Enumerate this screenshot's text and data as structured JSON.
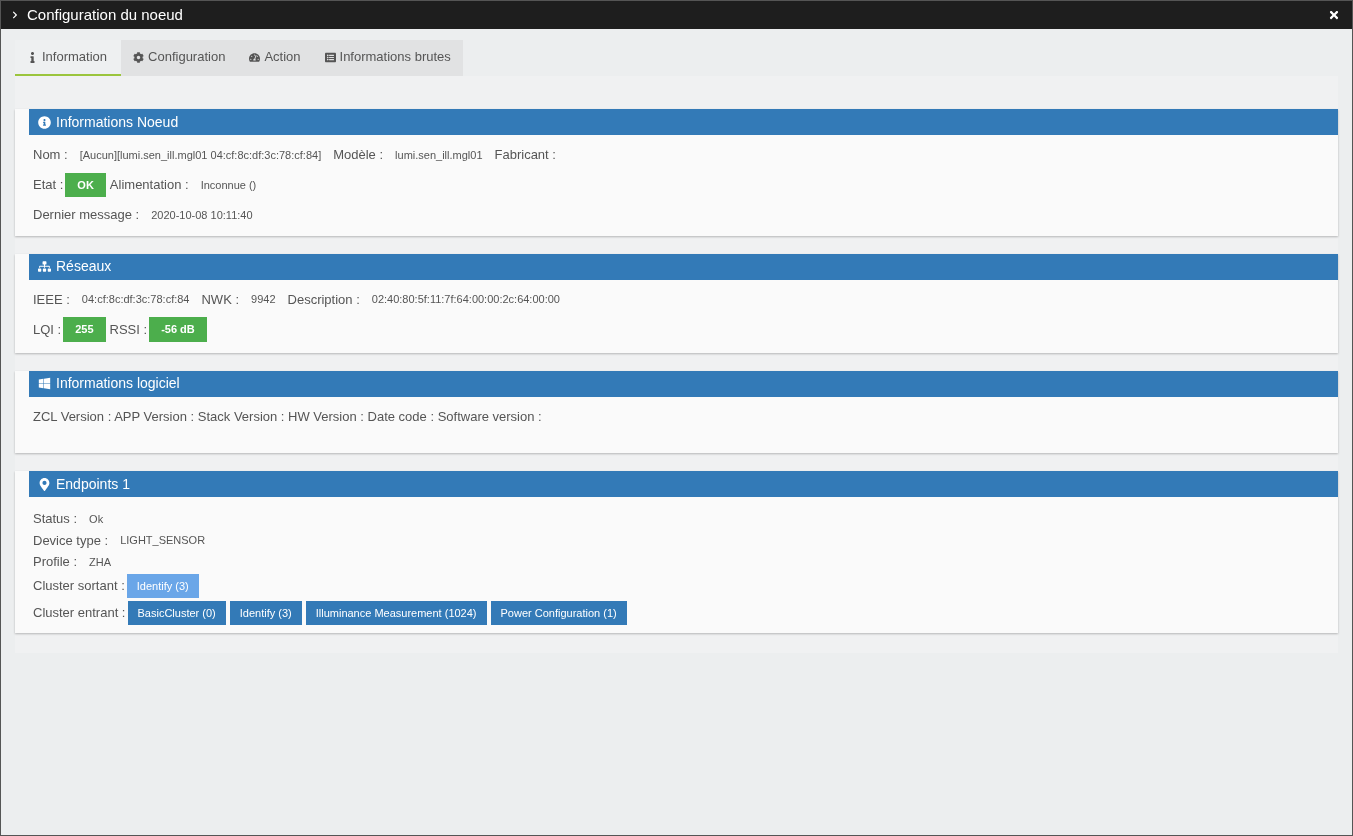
{
  "window": {
    "title": "Configuration du noeud"
  },
  "tabs": [
    {
      "label": "Information",
      "selected": true
    },
    {
      "label": "Configuration",
      "selected": false
    },
    {
      "label": "Action",
      "selected": false
    },
    {
      "label": "Informations brutes",
      "selected": false
    }
  ],
  "sections": [
    {
      "title": "Informations Noeud",
      "kind": "info",
      "lines": [
        {
          "fields": [
            {
              "label": "Nom :",
              "value": "[Aucun][lumi.sen_ill.mgl01 04:cf:8c:df:3c:78:cf:84]",
              "kind": "text"
            },
            {
              "label": "Modèle :",
              "value": "lumi.sen_ill.mgl01",
              "kind": "text"
            },
            {
              "label": "Fabricant :",
              "kind": "text"
            }
          ]
        },
        {
          "fields": [
            {
              "label": "Etat :",
              "value": "OK",
              "kind": "badge"
            },
            {
              "label": "Alimentation :",
              "value": "Inconnue ()",
              "kind": "text"
            }
          ]
        },
        {
          "fields": [
            {
              "label": "Dernier message :",
              "value": "2020-10-08 10:11:40",
              "kind": "text"
            }
          ]
        }
      ]
    },
    {
      "title": "Réseaux",
      "kind": "info",
      "lines": [
        {
          "fields": [
            {
              "label": "IEEE :",
              "value": "04:cf:8c:df:3c:78:cf:84",
              "kind": "text"
            },
            {
              "label": "NWK :",
              "value": "9942",
              "kind": "text"
            },
            {
              "label": "Description :",
              "value": "02:40:80:5f:11:7f:64:00:00:2c:64:00:00",
              "kind": "text"
            }
          ]
        },
        {
          "fields": [
            {
              "label": "LQI :",
              "value": "255",
              "kind": "badge"
            },
            {
              "label": "RSSI :",
              "value": "-56 dB",
              "kind": "badge"
            }
          ]
        }
      ]
    },
    {
      "title": "Informations logiciel",
      "kind": "info",
      "lines": [
        {
          "fields": [
            {
              "label": "ZCL Version : APP Version : Stack Version : HW Version : Date code : Software version :",
              "kind": "text"
            }
          ]
        }
      ]
    },
    {
      "title": "Endpoints 1",
      "kind": "endpoint",
      "lines": [
        {
          "fields": [
            {
              "label": "Status :",
              "value": "Ok",
              "kind": "text"
            }
          ]
        },
        {
          "fields": [
            {
              "label": "Device type :",
              "value": "LIGHT_SENSOR",
              "kind": "text"
            }
          ]
        },
        {
          "fields": [
            {
              "label": "Profile :",
              "value": "ZHA",
              "kind": "text"
            }
          ]
        },
        {
          "fields": [
            {
              "label": "Cluster sortant :",
              "tags": [
                "Identify (3)"
              ],
              "kind": "out"
            }
          ]
        },
        {
          "fields": [
            {
              "label": "Cluster entrant :",
              "tags": [
                "BasicCluster (0)",
                "Identify (3)",
                "Illuminance Measurement (1024)",
                "Power Configuration (1)"
              ],
              "kind": "in"
            }
          ]
        }
      ]
    }
  ]
}
